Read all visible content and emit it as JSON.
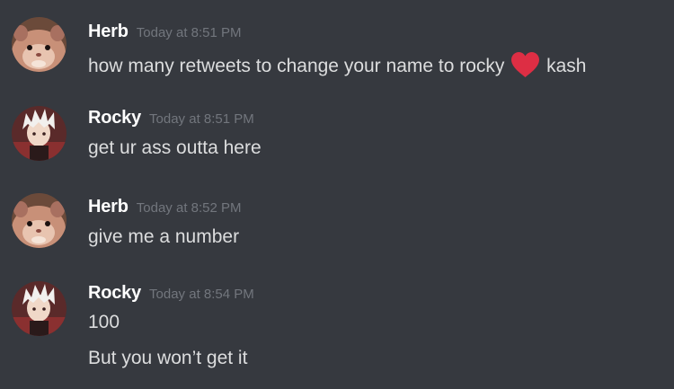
{
  "messages": [
    {
      "author": "Herb",
      "timestamp": "Today at 8:51 PM",
      "avatar": "hamster-avatar",
      "lines": [
        {
          "before": "how many retweets to change your name to rocky",
          "emoji": "red-heart-icon",
          "after": "kash"
        }
      ]
    },
    {
      "author": "Rocky",
      "timestamp": "Today at 8:51 PM",
      "avatar": "anime-boy-avatar",
      "lines": [
        "get ur ass outta here"
      ]
    },
    {
      "author": "Herb",
      "timestamp": "Today at 8:52 PM",
      "avatar": "hamster-avatar",
      "lines": [
        "give me a number"
      ]
    },
    {
      "author": "Rocky",
      "timestamp": "Today at 8:54 PM",
      "avatar": "anime-boy-avatar",
      "lines": [
        "100",
        "But you won’t get it"
      ]
    }
  ],
  "colors": {
    "background": "#36393f",
    "username": "#ffffff",
    "timestamp": "#72767d",
    "message_text": "#dcddde",
    "heart": "#dd2e44"
  }
}
